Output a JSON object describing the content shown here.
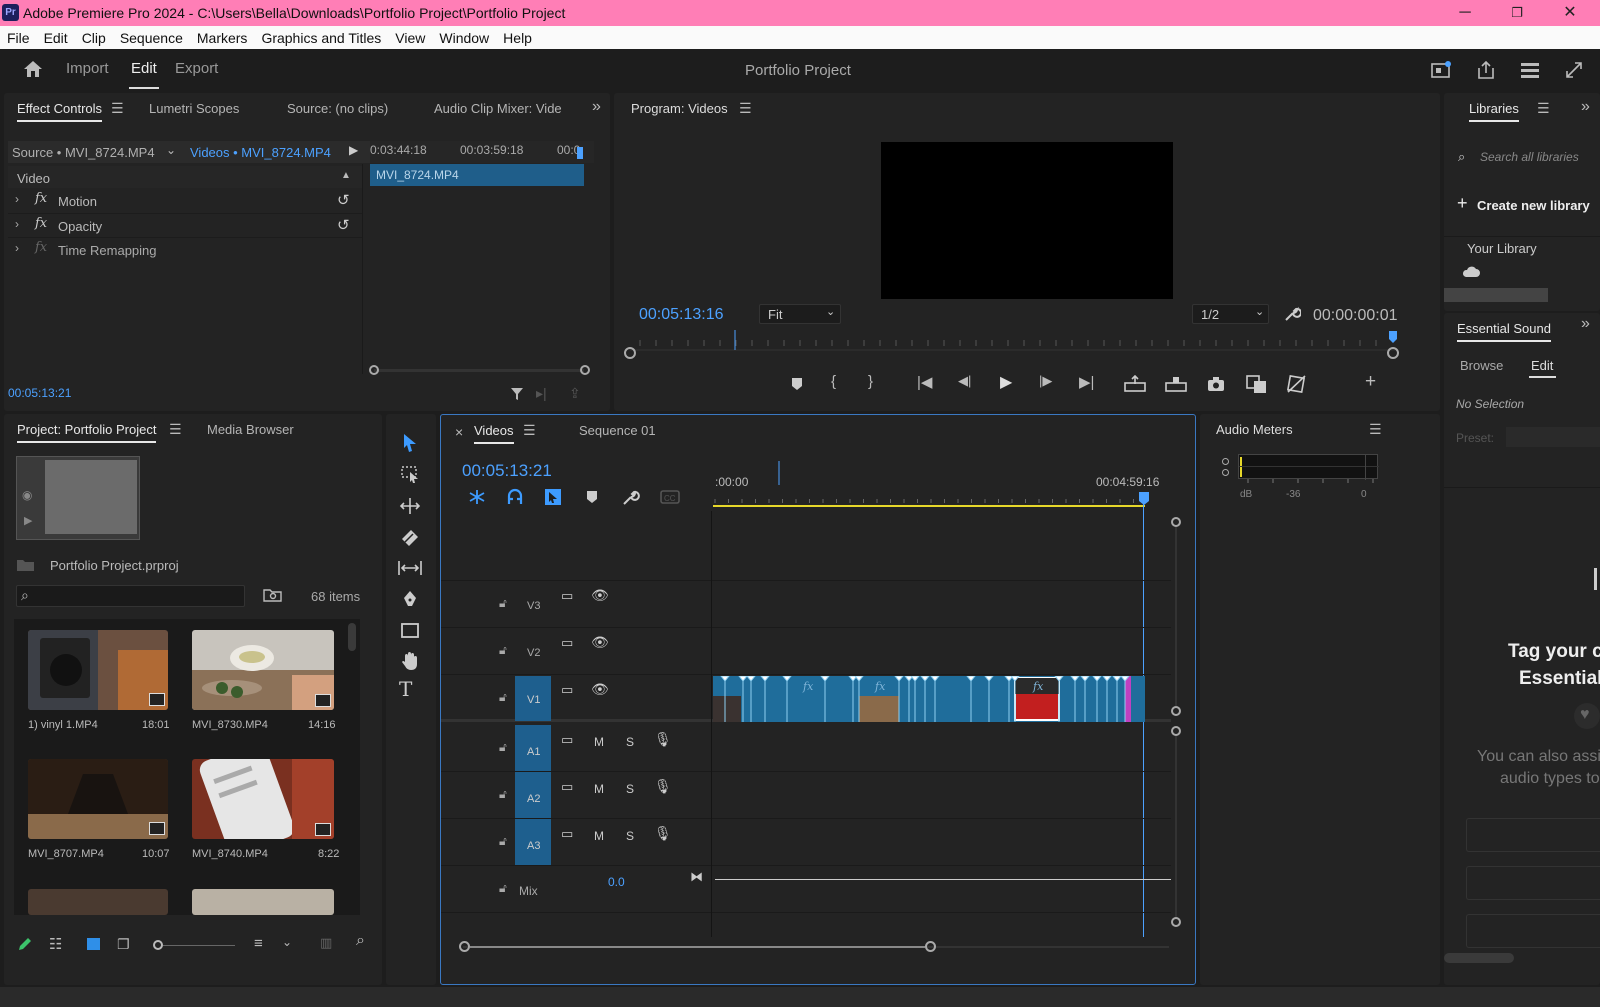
{
  "window": {
    "app_abbrev": "Pr",
    "title": "Adobe Premiere Pro 2024 - C:\\Users\\Bella\\Downloads\\Portfolio Project\\Portfolio Project",
    "minimize": "─",
    "restore": "❐",
    "close": "✕"
  },
  "menu": [
    "File",
    "Edit",
    "Clip",
    "Sequence",
    "Markers",
    "Graphics and Titles",
    "View",
    "Window",
    "Help"
  ],
  "workspace": {
    "tabs": [
      "Import",
      "Edit",
      "Export"
    ],
    "active": "Edit",
    "project_title": "Portfolio Project"
  },
  "effect_controls": {
    "tabs": [
      "Effect Controls",
      "Lumetri Scopes",
      "Source: (no clips)",
      "Audio Clip Mixer: Vide"
    ],
    "source_label": "Source • MVI_8724.MP4",
    "sequence_label": "Videos • MVI_8724.MP4",
    "ruler": [
      "0:03:44:18",
      "00:03:59:18",
      "00:0"
    ],
    "clip_name": "MVI_8724.MP4",
    "section": "Video",
    "effects": [
      "Motion",
      "Opacity",
      "Time Remapping"
    ],
    "timecode": "00:05:13:21"
  },
  "program": {
    "tab": "Program: Videos",
    "timecode": "00:05:13:16",
    "fit": "Fit",
    "resolution": "1/2",
    "duration": "00:00:00:01"
  },
  "libraries": {
    "tab": "Libraries",
    "search_placeholder": "Search all libraries",
    "create": "Create new library",
    "your_library": "Your Library"
  },
  "essential_sound": {
    "tab": "Essential Sound",
    "subtabs": [
      "Browse",
      "Edit"
    ],
    "no_selection": "No Selection",
    "preset": "Preset:",
    "tag_line1": "Tag your c",
    "tag_line2": "Essential",
    "also_line1": "You can also assi",
    "also_line2": "audio types to"
  },
  "project": {
    "tabs": [
      "Project: Portfolio Project",
      "Media Browser"
    ],
    "file": "Portfolio Project.prproj",
    "items": "68 items",
    "clips": [
      {
        "name": "1) vinyl 1.MP4",
        "duration": "18:01"
      },
      {
        "name": "MVI_8730.MP4",
        "duration": "14:16"
      },
      {
        "name": "MVI_8707.MP4",
        "duration": "10:07"
      },
      {
        "name": "MVI_8740.MP4",
        "duration": "8:22"
      }
    ]
  },
  "timeline": {
    "tabs": [
      "Videos",
      "Sequence 01"
    ],
    "close": "×",
    "timecode": "00:05:13:21",
    "ruler_start": ":00:00",
    "ruler_end": "00:04:59:16",
    "video_tracks": [
      "V3",
      "V2",
      "V1"
    ],
    "audio_tracks": [
      "A1",
      "A2",
      "A3"
    ],
    "mute": "M",
    "solo": "S",
    "mix_label": "Mix",
    "mix_value": "0.0"
  },
  "audio_meters": {
    "tab": "Audio Meters",
    "scale": [
      "dB",
      "-36",
      "0"
    ]
  },
  "colors": {
    "accent": "#4ca1ff",
    "titlebar": "#ff7eb6",
    "clip": "#1f6d9b",
    "track_active": "#1e5f8e"
  }
}
